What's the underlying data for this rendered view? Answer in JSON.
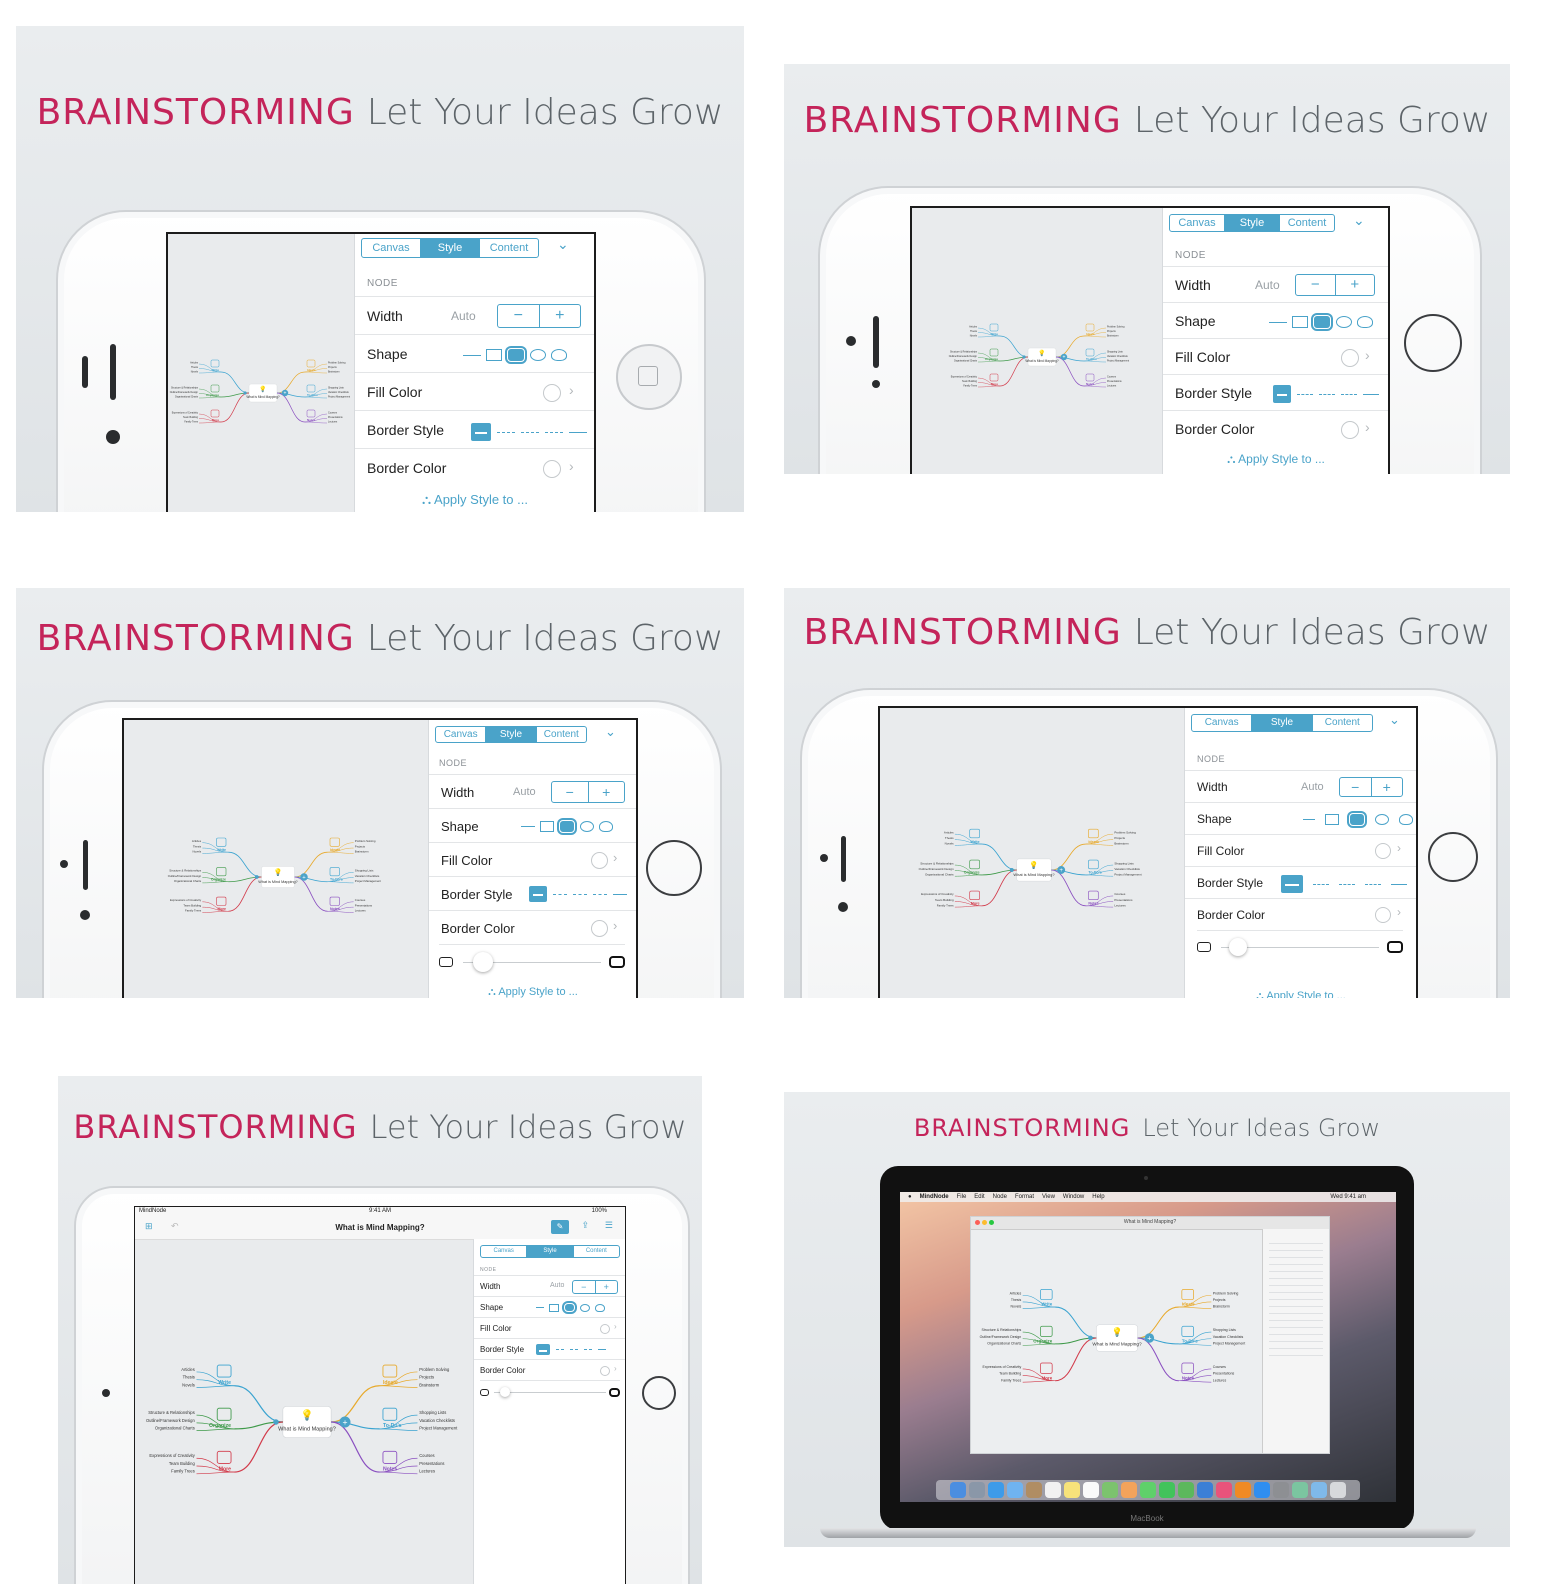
{
  "headline": {
    "highlight": "BRAINSTORMING",
    "tagline": "Let Your Ideas Grow"
  },
  "inspector": {
    "tabs": [
      "Canvas",
      "Style",
      "Content"
    ],
    "active_tab": "Style",
    "section": "NODE",
    "width_label": "Width",
    "width_value": "Auto",
    "minus": "−",
    "plus": "+",
    "shape_label": "Shape",
    "fill_label": "Fill Color",
    "border_style_label": "Border Style",
    "border_color_label": "Border Color",
    "apply_label": "Apply Style to ..."
  },
  "mindmap": {
    "center": "What is Mind Mapping?",
    "branches": [
      {
        "name": "Write",
        "color": "#3aa3d0",
        "items": [
          "Articles",
          "Thesis",
          "Novels"
        ]
      },
      {
        "name": "Organize",
        "color": "#3f9a4a",
        "items": [
          "Structure & Relationships",
          "Outline/Framework Design",
          "Organizational Charts"
        ]
      },
      {
        "name": "More",
        "color": "#d23a4a",
        "items": [
          "Expressions of Creativity",
          "Team Building",
          "Family Trees"
        ]
      },
      {
        "name": "Ideate",
        "color": "#e8a92a",
        "items": [
          "Problem Solving",
          "Projects",
          "Brainstorm"
        ]
      },
      {
        "name": "To-Do's",
        "color": "#3aa3d0",
        "items": [
          "Shopping Lists",
          "Vacation Checklists",
          "Project Management"
        ]
      },
      {
        "name": "Notes",
        "color": "#8a4fc0",
        "items": [
          "Courses",
          "Presentations",
          "Lectures"
        ]
      }
    ]
  },
  "ipad": {
    "carrier": "MindNode",
    "time": "9:41 AM",
    "battery": "100%",
    "doc_title": "What is Mind Mapping?"
  },
  "mac": {
    "menu": [
      "MindNode",
      "File",
      "Edit",
      "Node",
      "Format",
      "View",
      "Window",
      "Help"
    ],
    "clock": "Wed 9:41 am",
    "window_title": "What is Mind Mapping?",
    "brand": "MacBook"
  },
  "colors": {
    "accent": "#4aa3c9",
    "brand": "#c4245a"
  }
}
